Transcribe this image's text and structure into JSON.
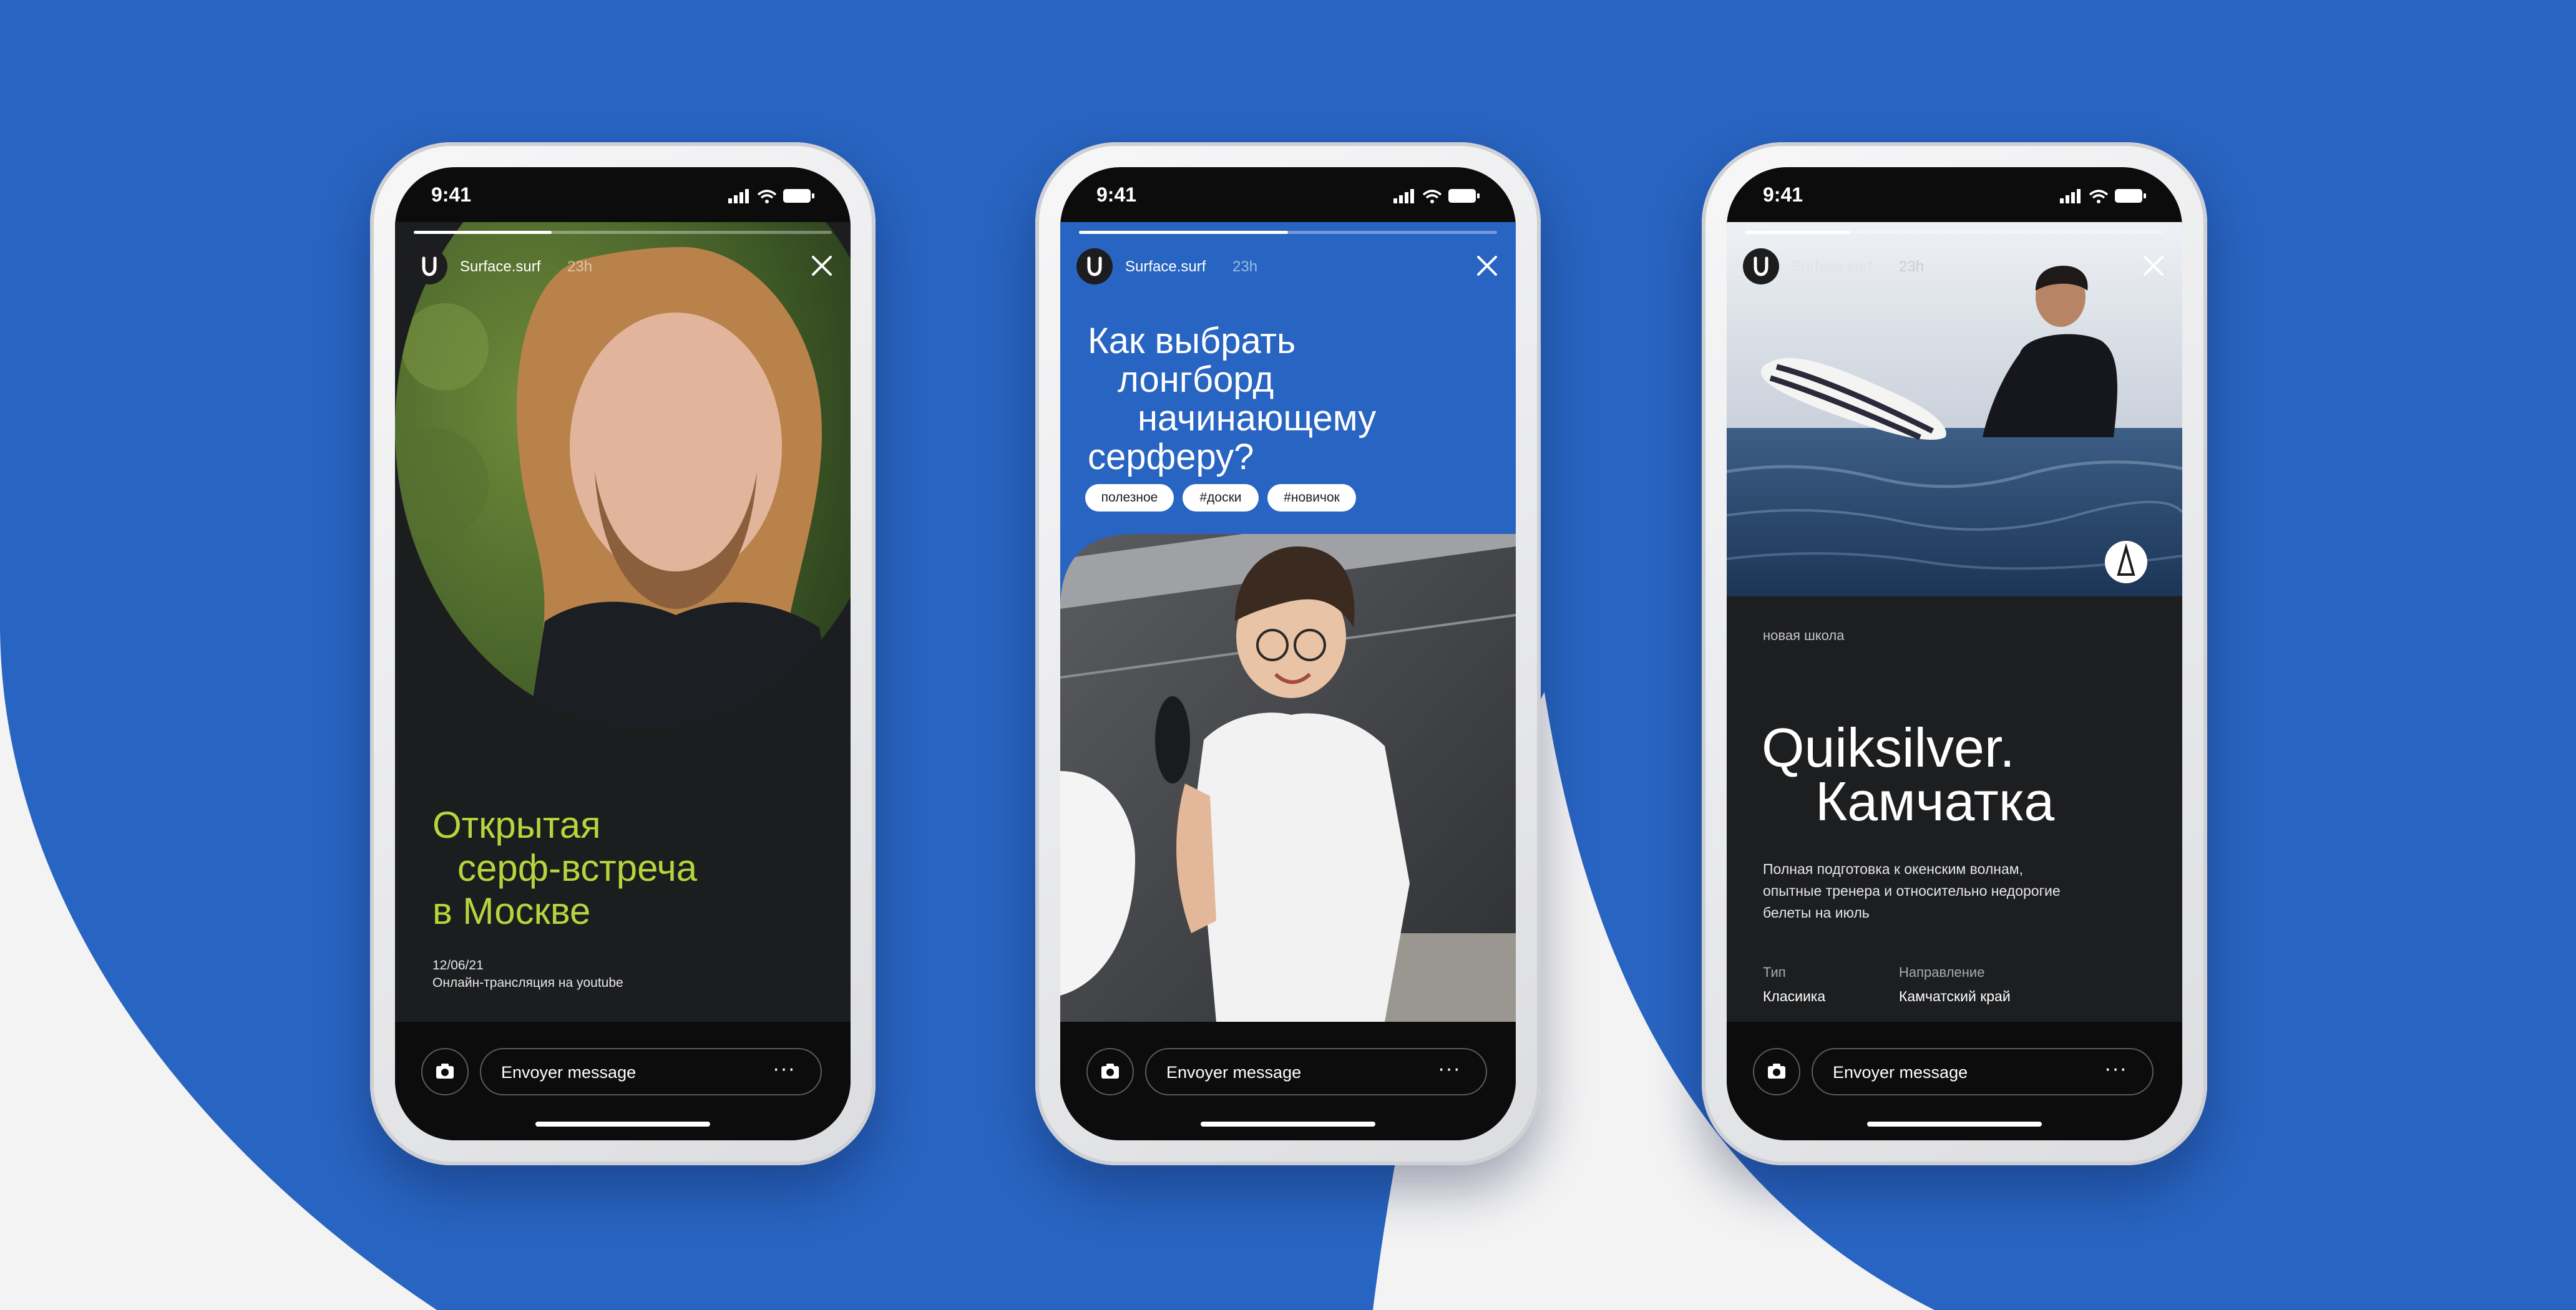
{
  "colors": {
    "brand_blue": "#2864c1",
    "lime": "#b4d63c",
    "page_bg": "#f3f3f4"
  },
  "phones": [
    {
      "time": "9:41",
      "username": "Surface.surf",
      "age": "23h",
      "progress": 0.33,
      "title_lines": [
        "Открытая",
        "серф-встреча",
        "в Москве"
      ],
      "date": "12/06/21",
      "subtitle": "Онлайн-трансляция на youtube",
      "message_placeholder": "Envoyer message"
    },
    {
      "time": "9:41",
      "username": "Surface.surf",
      "age": "23h",
      "progress": 0.5,
      "title_lines": [
        "Как выбрать",
        "лонгборд",
        "начинающему",
        "серферу?"
      ],
      "tags": [
        "полезное",
        "#доски",
        "#новичок"
      ],
      "message_placeholder": "Envoyer message"
    },
    {
      "time": "9:41",
      "username": "Surface.surf",
      "age": "23h",
      "progress": 0.25,
      "kicker": "новая школа",
      "title_lines": [
        "Quiksilver.",
        "Камчатка"
      ],
      "description_lines": [
        "Полная подготовка к окенским волнам,",
        "опытные тренера и относительно недорогие",
        "белеты на июль"
      ],
      "meta": [
        {
          "label": "Тип",
          "value": "Класиика"
        },
        {
          "label": "Направление",
          "value": "Камчатский край"
        }
      ],
      "message_placeholder": "Envoyer message"
    }
  ]
}
